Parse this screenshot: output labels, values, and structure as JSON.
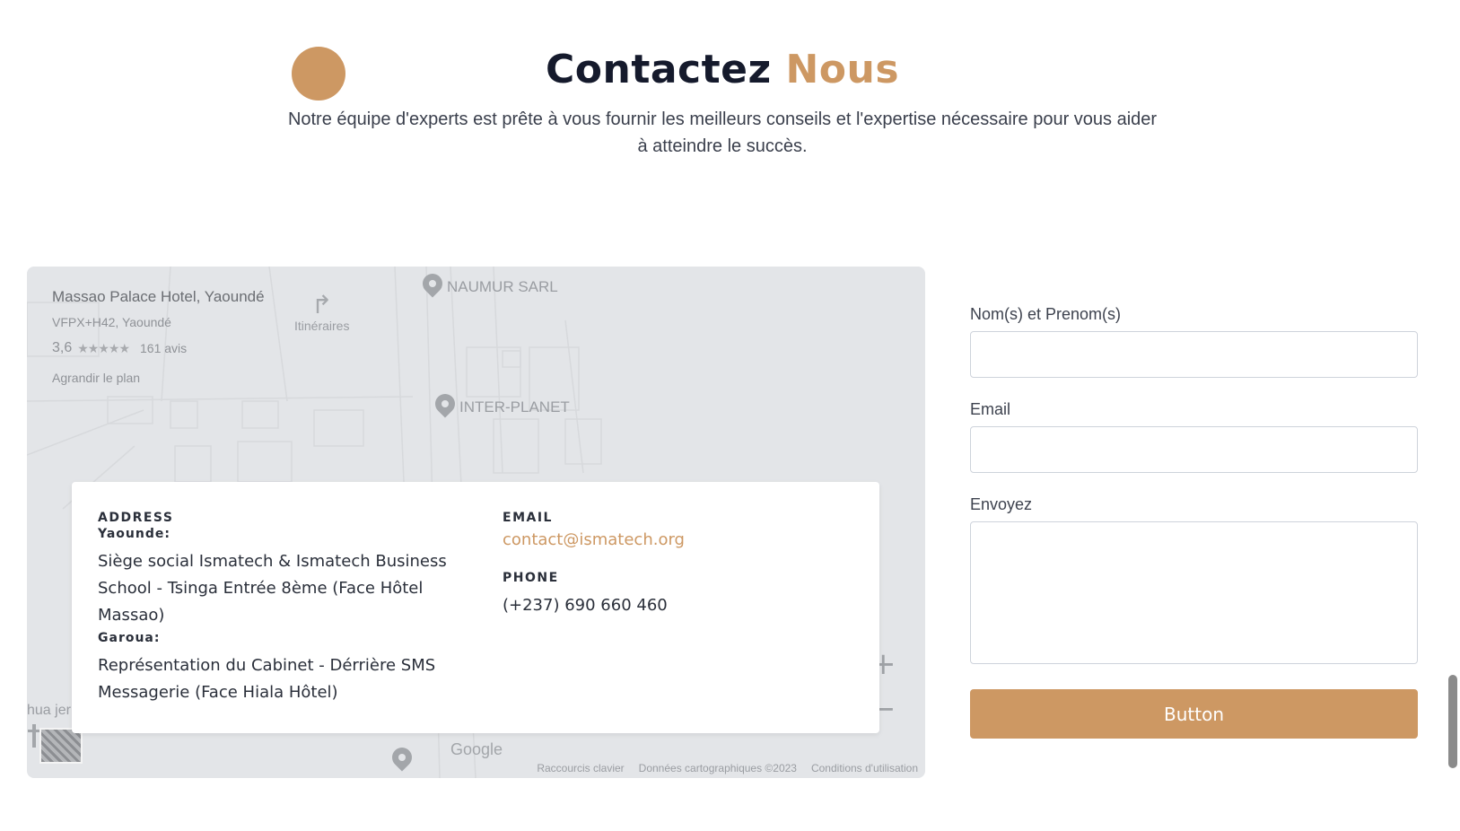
{
  "header": {
    "title_main": "Contactez",
    "title_accent": "Nous",
    "subtitle": "Notre équipe d'experts est prête à vous fournir les meilleurs conseils et l'expertise nécessaire pour vous aider à atteindre le succès."
  },
  "map": {
    "place_name": "Massao Palace Hotel, Yaoundé",
    "place_address": "VFPX+H42, Yaoundé",
    "rating": "3,6",
    "stars": "★★★★★",
    "reviews": "161 avis",
    "enlarge_label": "Agrandir le plan",
    "directions_label": "Itinéraires",
    "pois": [
      "NAUMUR SARL",
      "INTER-PLANET"
    ],
    "partial_label": "hua jer",
    "logo": "Google",
    "footer": [
      "Raccourcis clavier",
      "Données cartographiques ©2023",
      "Conditions d'utilisation"
    ],
    "zoom_in": "+",
    "zoom_out": "−"
  },
  "info": {
    "address_label": "ADDRESS",
    "city1_label": "Yaounde:",
    "city1_text": "Siège social Ismatech & Ismatech Business School - Tsinga Entrée 8ème (Face Hôtel Massao)",
    "city2_label": "Garoua:",
    "city2_text": "Représentation du Cabinet - Dérrière SMS Messagerie (Face Hiala Hôtel)",
    "email_label": "EMAIL",
    "email": "contact@ismatech.org",
    "phone_label": "PHONE",
    "phone": "(+237) 690 660 460"
  },
  "form": {
    "name_label": "Nom(s) et Prenom(s)",
    "name_value": "",
    "email_label": "Email",
    "email_value": "",
    "message_label": "Envoyez",
    "message_value": "",
    "submit_label": "Button"
  },
  "colors": {
    "accent": "#cd9863",
    "heading": "#151a2c",
    "map_bg": "#e3e5e8"
  }
}
